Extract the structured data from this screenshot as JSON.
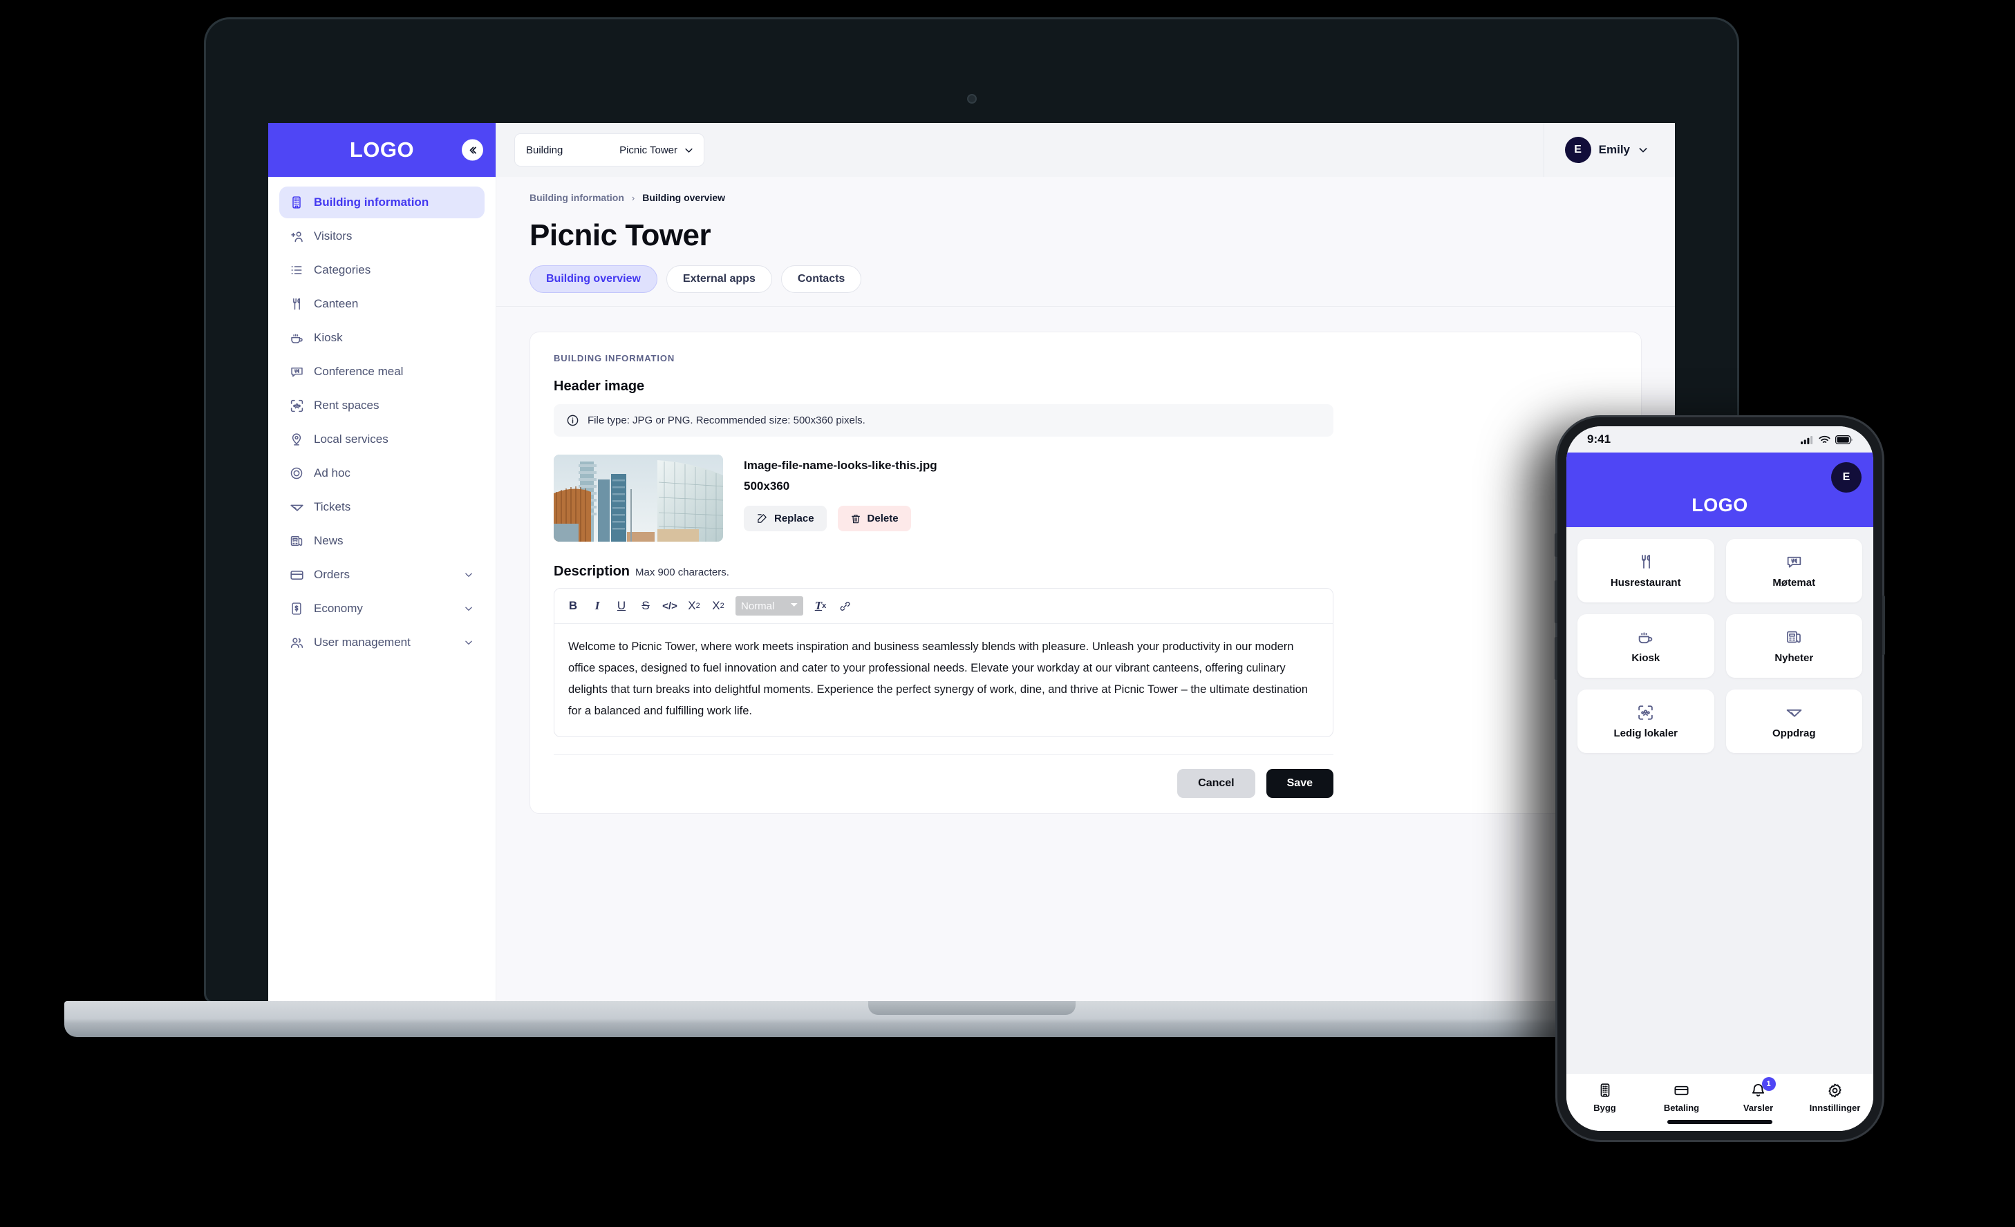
{
  "brand": {
    "logo_text": "LOGO",
    "accent_color": "#4f46f5",
    "dark_color": "#120e3a"
  },
  "desktop": {
    "collapse_icon": "chevron-double-left-icon",
    "topbar": {
      "building_picker": {
        "label": "Building",
        "value": "Picnic Tower",
        "chevron": "chevron-down-icon"
      },
      "user": {
        "initial": "E",
        "name": "Emily",
        "chevron": "chevron-down-icon"
      }
    },
    "sidebar": {
      "items": [
        {
          "label": "Building information",
          "icon": "building-icon",
          "active": true,
          "expandable": false
        },
        {
          "label": "Visitors",
          "icon": "user-plus-icon",
          "active": false,
          "expandable": false
        },
        {
          "label": "Categories",
          "icon": "list-icon",
          "active": false,
          "expandable": false
        },
        {
          "label": "Canteen",
          "icon": "cutlery-icon",
          "active": false,
          "expandable": false
        },
        {
          "label": "Kiosk",
          "icon": "coffee-cup-icon",
          "active": false,
          "expandable": false
        },
        {
          "label": "Conference meal",
          "icon": "meal-chat-icon",
          "active": false,
          "expandable": false
        },
        {
          "label": "Rent spaces",
          "icon": "scan-people-icon",
          "active": false,
          "expandable": false
        },
        {
          "label": "Local services",
          "icon": "map-pin-user-icon",
          "active": false,
          "expandable": false
        },
        {
          "label": "Ad hoc",
          "icon": "target-icon",
          "active": false,
          "expandable": false
        },
        {
          "label": "Tickets",
          "icon": "paper-plane-icon",
          "active": false,
          "expandable": false
        },
        {
          "label": "News",
          "icon": "newspaper-icon",
          "active": false,
          "expandable": false
        },
        {
          "label": "Orders",
          "icon": "card-icon",
          "active": false,
          "expandable": true
        },
        {
          "label": "Economy",
          "icon": "receipt-icon",
          "active": false,
          "expandable": true
        },
        {
          "label": "User management",
          "icon": "users-icon",
          "active": false,
          "expandable": true
        }
      ]
    },
    "breadcrumb": {
      "parent": "Building information",
      "separator": "›",
      "current": "Building overview"
    },
    "page_title": "Picnic Tower",
    "tabs": [
      {
        "label": "Building overview",
        "active": true
      },
      {
        "label": "External apps",
        "active": false
      },
      {
        "label": "Contacts",
        "active": false
      }
    ],
    "card": {
      "eyebrow": "BUILDING INFORMATION",
      "header_image_label": "Header image",
      "info_icon": "info-circle-icon",
      "info_text": "File type: JPG or PNG. Recommended size: 500x360 pixels.",
      "image": {
        "filename": "Image-file-name-looks-like-this.jpg",
        "dimensions": "500x360",
        "replace_label": "Replace",
        "replace_icon": "pencil-square-icon",
        "delete_label": "Delete",
        "delete_icon": "trash-icon"
      },
      "description_label": "Description",
      "description_hint": "Max 900 characters.",
      "toolbar": {
        "bold": "B",
        "italic": "I",
        "underline": "U",
        "strike": "S",
        "code": "</>",
        "subscript_base": "X",
        "subscript_sub": "2",
        "superscript_base": "X",
        "superscript_sup": "2",
        "format_value": "Normal",
        "format_options": [
          "Normal"
        ],
        "clear_format_base": "T",
        "clear_format_sub": "x",
        "link_icon": "link-icon"
      },
      "description_text": "Welcome to Picnic Tower, where work meets inspiration and business seamlessly blends with pleasure. Unleash your productivity in our modern office spaces, designed to fuel innovation and cater to your professional needs. Elevate your workday at our vibrant canteens, offering culinary delights that turn breaks into delightful moments. Experience the perfect synergy of work, dine, and thrive at Picnic Tower – the ultimate destination for a balanced and fulfilling work life.",
      "cancel_label": "Cancel",
      "save_label": "Save"
    }
  },
  "mobile": {
    "status": {
      "time": "9:41",
      "cellular_icon": "signal-bars-icon",
      "wifi_icon": "wifi-icon",
      "battery_icon": "battery-icon"
    },
    "header": {
      "logo_text": "LOGO",
      "avatar_initial": "E"
    },
    "tiles": [
      {
        "label": "Husrestaurant",
        "icon": "cutlery-icon"
      },
      {
        "label": "Møtemat",
        "icon": "meal-chat-icon"
      },
      {
        "label": "Kiosk",
        "icon": "coffee-cup-icon"
      },
      {
        "label": "Nyheter",
        "icon": "newspaper-icon"
      },
      {
        "label": "Ledig lokaler",
        "icon": "scan-people-icon"
      },
      {
        "label": "Oppdrag",
        "icon": "paper-plane-icon"
      }
    ],
    "tabbar": [
      {
        "label": "Bygg",
        "icon": "building-icon",
        "badge": null
      },
      {
        "label": "Betaling",
        "icon": "card-icon",
        "badge": null
      },
      {
        "label": "Varsler",
        "icon": "bell-icon",
        "badge": "1"
      },
      {
        "label": "Innstillinger",
        "icon": "gear-icon",
        "badge": null
      }
    ]
  }
}
